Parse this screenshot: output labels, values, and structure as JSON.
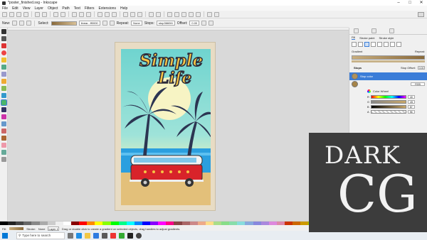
{
  "window": {
    "title": "*poster_finished.svg - Inkscape",
    "controls": [
      "–",
      "□",
      "✕"
    ]
  },
  "menu": [
    "File",
    "Edit",
    "View",
    "Layer",
    "Object",
    "Path",
    "Text",
    "Filters",
    "Extensions",
    "Help"
  ],
  "ctrl": {
    "new_label": "New:",
    "select_label": "Select:",
    "select_value": "linear...ff0000",
    "repeat_label": "Repeat:",
    "repeat_value": "None",
    "stops_label": "Stops:",
    "stops_value": "stop3660f4",
    "offset_label": "Offset:",
    "offset_value": "0.00"
  },
  "poster": {
    "line1": "Simple",
    "line2": "Life"
  },
  "panel": {
    "tabs": [
      "Fill",
      "Stroke paint",
      "Stroke style"
    ],
    "gradient_label": "Gradient",
    "repeat_label": "Repeat:",
    "stops_section": "Stops",
    "stop_offset_label": "Stop Offset:",
    "stop_offset_value": "0.00",
    "stop_color_label": "Stop color",
    "mode_value": "RGB",
    "color_wheel_label": "Color Wheel",
    "sliders": [
      {
        "label": "R",
        "value": "40"
      },
      {
        "label": "G",
        "value": "45"
      },
      {
        "label": "B",
        "value": "87"
      },
      {
        "label": "A",
        "value": "96"
      }
    ]
  },
  "status": {
    "fill_label": "Fill:",
    "stroke_label": "Stroke:",
    "none_label": "None",
    "layer_value": "Layer 1",
    "hint": "Drag or double click to create a gradient on selected objects, drag handles to adjust gradients."
  },
  "taskbar": {
    "search_placeholder": "Type here to search"
  },
  "watermark": {
    "line1": "DARK",
    "line2": "CG"
  },
  "colors": {
    "accent": "#3b7dd8",
    "poster_sky": "#6fd4cf",
    "bus_red": "#d8232a",
    "title_yellow": "#f6c445"
  }
}
